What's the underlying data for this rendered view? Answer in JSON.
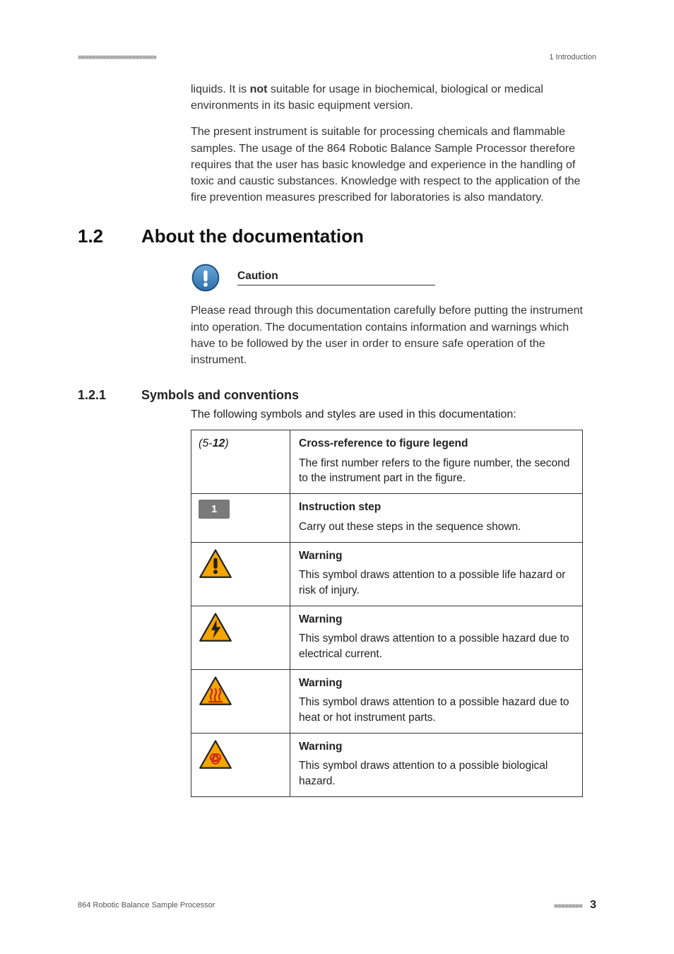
{
  "header": {
    "dashes": "■■■■■■■■■■■■■■■■■■■■■■",
    "right": "1 Introduction"
  },
  "p1_a": "liquids. It is ",
  "p1_bold": "not",
  "p1_b": " suitable for usage in biochemical, biological or medical environments in its basic equipment version.",
  "p2": "The present instrument is suitable for processing chemicals and flammable samples. The usage of the 864 Robotic Balance Sample Processor therefore requires that the user has basic knowledge and experience in the handling of toxic and caustic substances. Knowledge with respect to the application of the fire prevention measures prescribed for laboratories is also mandatory.",
  "sec12_num": "1.2",
  "sec12_title": "About the documentation",
  "caution": {
    "title": "Caution",
    "text": "Please read through this documentation carefully before putting the instrument into operation. The documentation contains information and warnings which have to be followed by the user in order to ensure safe operation of the instrument."
  },
  "sec121_num": "1.2.1",
  "sec121_title": "Symbols and conventions",
  "symbols_intro": "The following symbols and styles are used in this documentation:",
  "rows": {
    "crossref": {
      "left_a": "(5-",
      "left_b": "12",
      "left_c": ")",
      "head": "Cross-reference to figure legend",
      "body": "The first number refers to the figure number, the second to the instrument part in the figure."
    },
    "step": {
      "badge": "1",
      "head": "Instruction step",
      "body": "Carry out these steps in the sequence shown."
    },
    "warn1": {
      "head": "Warning",
      "body": "This symbol draws attention to a possible life hazard or risk of injury."
    },
    "warn2": {
      "head": "Warning",
      "body": "This symbol draws attention to a possible hazard due to electrical current."
    },
    "warn3": {
      "head": "Warning",
      "body": "This symbol draws attention to a possible hazard due to heat or hot instrument parts."
    },
    "warn4": {
      "head": "Warning",
      "body": "This symbol draws attention to a possible biological hazard."
    }
  },
  "footer": {
    "left": "864 Robotic Balance Sample Processor",
    "dashes": "■■■■■■■■",
    "page": "3"
  }
}
